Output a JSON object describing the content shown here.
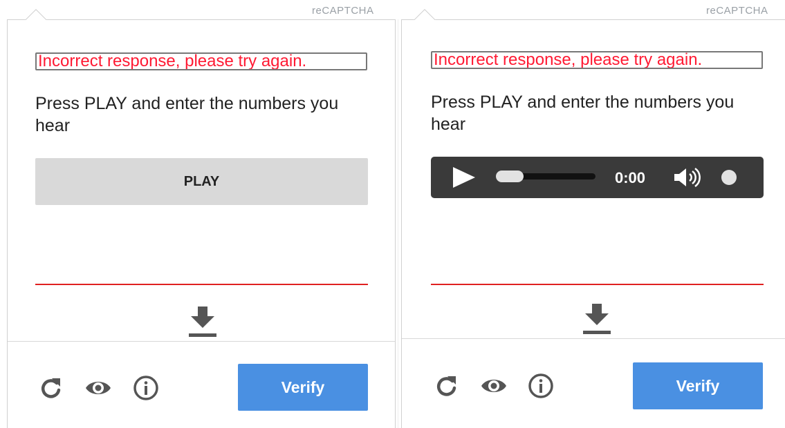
{
  "panels": [
    {
      "brand": "reCAPTCHA",
      "error_message": "Incorrect response, please try again.",
      "instructions": "Press PLAY and enter the numbers you hear",
      "play_label": "PLAY",
      "verify_label": "Verify"
    },
    {
      "brand": "reCAPTCHA",
      "error_message": "Incorrect response, please try again.",
      "instructions": "Press PLAY and enter the numbers you hear",
      "player": {
        "time": "0:00"
      },
      "verify_label": "Verify"
    }
  ],
  "icons": {
    "reload": "reload-icon",
    "visual": "eye-icon",
    "info": "info-icon",
    "download": "download-icon",
    "play": "play-icon",
    "volume": "volume-icon"
  },
  "colors": {
    "error_text": "#ff1a33",
    "response_line": "#e02020",
    "verify_button": "#4a90e2",
    "play_button": "#d9d9d9",
    "player_bg": "#3a3a3a"
  }
}
